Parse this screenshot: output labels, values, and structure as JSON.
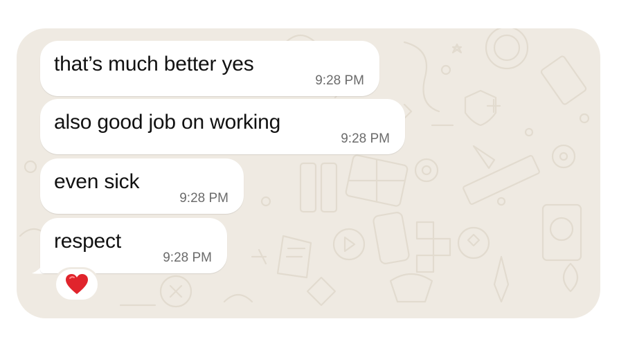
{
  "colors": {
    "background": "#ffffff",
    "chat_wallpaper": "#efeae2",
    "bubble": "#ffffff",
    "text": "#111111",
    "timestamp": "#6b6b6b",
    "reaction_heart": "#e0242c"
  },
  "messages": [
    {
      "text": "that’s much better yes",
      "time": "9:28 PM"
    },
    {
      "text": "also good job on working",
      "time": "9:28 PM"
    },
    {
      "text": "even sick",
      "time": "9:28 PM"
    },
    {
      "text": "respect",
      "time": "9:28 PM"
    }
  ],
  "reaction": {
    "icon": "red-heart-icon"
  }
}
